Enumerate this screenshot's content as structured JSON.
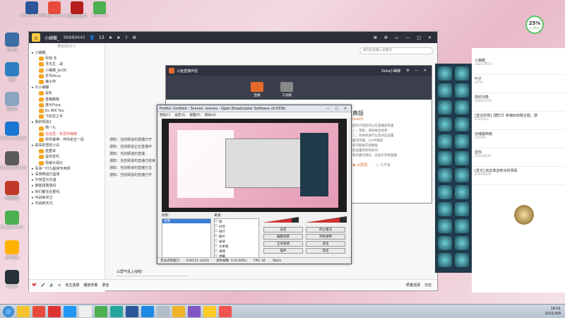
{
  "desktop": {
    "left_icons": [
      "计算机",
      "网络",
      "回收站",
      "Internet Explorer",
      "LOL Blend Panel",
      "英雄联盟",
      "EasyConnect",
      "360游戏",
      "Steam"
    ],
    "top_icons": [
      "Microsoft Word",
      "Google Chrome",
      "正版英雄联盟",
      "Minecraft"
    ]
  },
  "perf": {
    "percent": "25%",
    "speed": "1.2K/s"
  },
  "main_window": {
    "user": "小蝴蝶_",
    "room_id": "86889645",
    "fans": "13",
    "search_placeholder": "请在此处输入关键词"
  },
  "left_panel": {
    "header": "排名前10人",
    "rows": [
      {
        "text": "小蝴蝶_",
        "type": "group"
      },
      {
        "text": "怜悯 冬",
        "type": "user"
      },
      {
        "text": "寻先生 - 战",
        "type": "user"
      },
      {
        "text": "小蝴蝶_Jsr26",
        "type": "user"
      },
      {
        "text": "岁月Ahra",
        "type": "user"
      },
      {
        "text": "诸子你",
        "type": "user"
      },
      {
        "text": "只小蝴蝶",
        "type": "group"
      },
      {
        "text": "战车",
        "type": "user"
      },
      {
        "text": "金蝴蝶我",
        "type": "user"
      },
      {
        "text": "渡大Fuya",
        "type": "user"
      },
      {
        "text": "Ks Will You",
        "type": "user"
      },
      {
        "text": "飞花花之半",
        "type": "user"
      },
      {
        "text": "我的频道2",
        "type": "group"
      },
      {
        "text": "杨一九",
        "type": "user"
      },
      {
        "text": "在这里：有爱的蝴蝶",
        "type": "highlight"
      },
      {
        "text": "伴你凝神：伴你走过一段",
        "type": "user"
      },
      {
        "text": "高昂的雪豹小白",
        "type": "group"
      },
      {
        "text": "送重单",
        "type": "user"
      },
      {
        "text": "是你去吗",
        "type": "user"
      },
      {
        "text": "情绪大哥比",
        "type": "user"
      },
      {
        "text": "军事一打九超级专用频",
        "type": "group"
      },
      {
        "text": "深夜畅谈打篮球",
        "type": "group"
      },
      {
        "text": "平常里乐乐谐",
        "type": "group"
      },
      {
        "text": "谁能拯救我吗",
        "type": "group"
      },
      {
        "text": "你们都住在那吗",
        "type": "group"
      },
      {
        "text": "内战房间卫",
        "type": "group"
      },
      {
        "text": "内战房天沉",
        "type": "group"
      }
    ]
  },
  "chat": {
    "notices": [
      "通知：当前频道的直播已开",
      "通知：当前频道正在直播中",
      "通知：当前频道的直播",
      "通知：当前频道的直播已结束",
      "通知：当前频道的直播已关",
      "通知：当前频道的直播已开"
    ],
    "input_text": "公屏气氛上线啦!",
    "bottom_items": [
      "自主选择",
      "播放伴奏",
      "录音",
      "质量选择",
      "日志"
    ]
  },
  "duoyu": {
    "title": "斗鱼直播伴侣",
    "tabs": [
      "直播",
      "工具箱"
    ],
    "user": "Dota小蝴蝶",
    "heading": "典版",
    "sub": "live03",
    "desc": [
      "提示介绍您可以在直播前检查",
      "一，常规，请关掉合适项",
      "二，对本机进行以及对应设置",
      "推流可能，1小时再起",
      "您可能就在观察里",
      "您设置的你的房间",
      "每次最次相比，这就于开始直播"
    ],
    "options": [
      "公屏调",
      "工作室"
    ]
  },
  "obs": {
    "title": "Profile: Untitled - Scenes: scenes - Open Broadcaster Software v0.659b",
    "menu": [
      "档案(F)",
      "设定(S)",
      "配置(P)",
      "帮助(H)"
    ],
    "scenes_label": "场景:",
    "scenes": [
      "场景"
    ],
    "sources_label": "来源:",
    "sources": [
      "窗",
      "抖音",
      "排行",
      "图片",
      "画卓",
      "文本框",
      "视频",
      "弹幕"
    ],
    "buttons": [
      "设定",
      "停止推流",
      "编辑场景",
      "开始录制",
      "全局来源",
      "退出",
      "插件",
      "退出"
    ],
    "status": [
      "无法识别窗口",
      "0:00:51 (LIVE)",
      "丢失帧数: 0 (0.00%)",
      "FPS: 44",
      "0kb/s"
    ]
  },
  "right_window": {
    "rows": [
      {
        "name": "小蝴蝶_",
        "meta": "2021/05/11"
      },
      {
        "name": "叶子",
        "meta": "2476"
      },
      {
        "name": "周红列表",
        "meta": "1280/2259"
      },
      {
        "name": "[直达的地]【群已】有嗨玩到我主题，感",
        "meta": "2020/9/1"
      },
      {
        "name": "勾魂最西装",
        "meta": "2020/9"
      },
      {
        "name": "显你",
        "meta": "2020/8/29"
      },
      {
        "name": "[发光] 快去收割奇点的事情",
        "meta": "2020/8/29"
      }
    ]
  },
  "taskbar": {
    "time": "19:01",
    "date": "2021/4/9"
  },
  "colors": {
    "accent": "#e56a2a",
    "titlebar": "#2b2f3a",
    "desktop": "#e8c7d3"
  }
}
